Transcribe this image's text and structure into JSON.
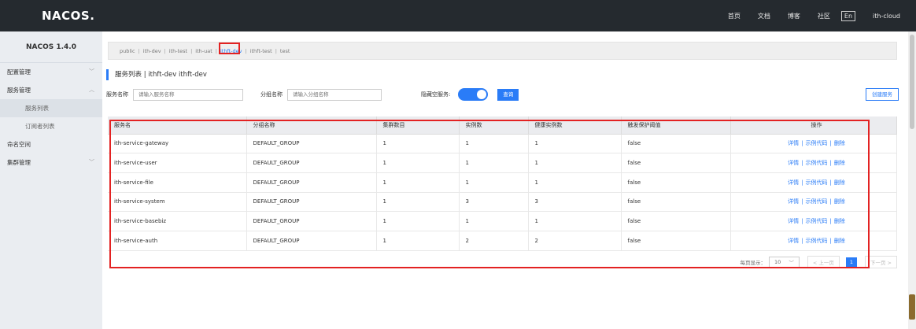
{
  "header": {
    "logo": "NACOS.",
    "nav": [
      "首页",
      "文档",
      "博客",
      "社区"
    ],
    "lang": "En",
    "user": "ith-cloud"
  },
  "sidebar": {
    "version": "NACOS 1.4.0",
    "items": [
      {
        "label": "配置管理",
        "chevron": "﹀",
        "sub": false
      },
      {
        "label": "服务管理",
        "chevron": "︿",
        "sub": false
      },
      {
        "label": "服务列表",
        "chevron": "",
        "sub": true,
        "active": true
      },
      {
        "label": "订阅者列表",
        "chevron": "",
        "sub": true
      },
      {
        "label": "命名空间",
        "chevron": "",
        "sub": false
      },
      {
        "label": "集群管理",
        "chevron": "﹀",
        "sub": false
      }
    ]
  },
  "namespaces": {
    "items": [
      "public",
      "ith-dev",
      "ith-test",
      "ith-uat",
      "ithft-dev",
      "ithft-test",
      "test"
    ],
    "active_index": 4
  },
  "page": {
    "title": "服务列表 | ithft-dev ithft-dev"
  },
  "filter": {
    "service_label": "服务名称",
    "service_placeholder": "请输入服务名称",
    "group_label": "分组名称",
    "group_placeholder": "请输入分组名称",
    "hide_empty_label": "隐藏空服务:",
    "hide_empty_on": true,
    "query_button": "查询",
    "create_button": "创建服务"
  },
  "table": {
    "columns": [
      "服务名",
      "分组名称",
      "集群数目",
      "实例数",
      "健康实例数",
      "触发保护阈值",
      "操作"
    ],
    "rows": [
      [
        "ith-service-gateway",
        "DEFAULT_GROUP",
        "1",
        "1",
        "1",
        "false"
      ],
      [
        "ith-service-user",
        "DEFAULT_GROUP",
        "1",
        "1",
        "1",
        "false"
      ],
      [
        "ith-service-file",
        "DEFAULT_GROUP",
        "1",
        "1",
        "1",
        "false"
      ],
      [
        "ith-service-system",
        "DEFAULT_GROUP",
        "1",
        "3",
        "3",
        "false"
      ],
      [
        "ith-service-basebiz",
        "DEFAULT_GROUP",
        "1",
        "1",
        "1",
        "false"
      ],
      [
        "ith-service-auth",
        "DEFAULT_GROUP",
        "1",
        "2",
        "2",
        "false"
      ]
    ],
    "actions": [
      "详情",
      "示例代码",
      "删除"
    ]
  },
  "pager": {
    "per_page_label": "每页显示：",
    "per_page": "10",
    "prev": "< 上一页",
    "current": "1",
    "next": "下一页 >"
  },
  "colors": {
    "header_bg": "#252a2f",
    "accent": "#2a7cf7",
    "highlight": "#e32222"
  }
}
